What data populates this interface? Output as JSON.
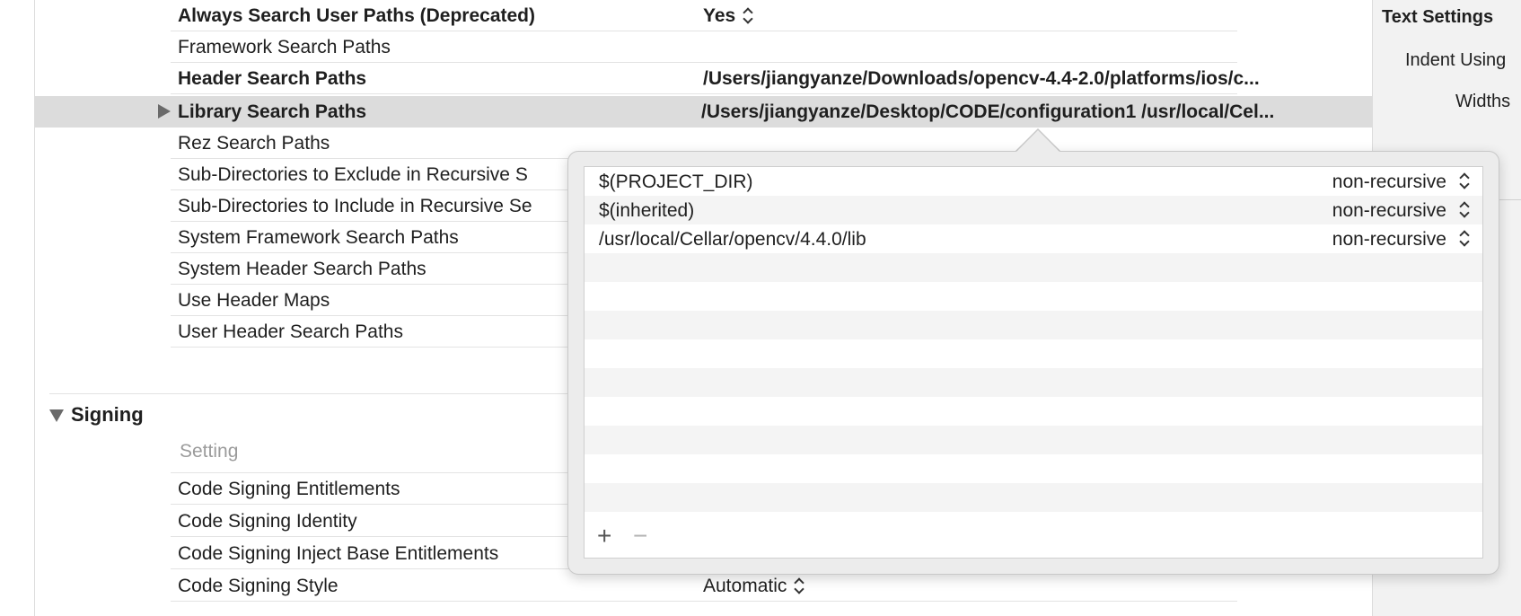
{
  "search_paths": {
    "rows": [
      {
        "name": "Always Search User Paths (Deprecated)",
        "value": "Yes",
        "bold": true,
        "stepper": true
      },
      {
        "name": "Framework Search Paths",
        "value": "",
        "bold": false,
        "stepper": false
      },
      {
        "name": "Header Search Paths",
        "value": "/Users/jiangyanze/Downloads/opencv-4.4-2.0/platforms/ios/c...",
        "bold": true,
        "stepper": false
      },
      {
        "name": "Library Search Paths",
        "value": "/Users/jiangyanze/Desktop/CODE/configuration1  /usr/local/Cel...",
        "bold": true,
        "stepper": false,
        "selected": true
      },
      {
        "name": "Rez Search Paths",
        "value": "",
        "bold": false
      },
      {
        "name": "Sub-Directories to Exclude in Recursive S",
        "value": "",
        "bold": false
      },
      {
        "name": "Sub-Directories to Include in Recursive Se",
        "value": "",
        "bold": false
      },
      {
        "name": "System Framework Search Paths",
        "value": "",
        "bold": false
      },
      {
        "name": "System Header Search Paths",
        "value": "",
        "bold": false
      },
      {
        "name": "Use Header Maps",
        "value": "",
        "bold": false
      },
      {
        "name": "User Header Search Paths",
        "value": "",
        "bold": false
      }
    ]
  },
  "signing": {
    "title": "Signing",
    "column_header": "Setting",
    "rows": [
      {
        "name": "Code Signing Entitlements",
        "value": ""
      },
      {
        "name": "Code Signing Identity",
        "value": ""
      },
      {
        "name": "Code Signing Inject Base Entitlements",
        "value": ""
      },
      {
        "name": "Code Signing Style",
        "value": "Automatic"
      }
    ]
  },
  "inspector": {
    "title": "Text Settings",
    "indent_label": "Indent Using",
    "widths_label": "Widths"
  },
  "popover": {
    "items": [
      {
        "path": "$(PROJECT_DIR)",
        "mode": "non-recursive"
      },
      {
        "path": "$(inherited)",
        "mode": "non-recursive"
      },
      {
        "path": "/usr/local/Cellar/opencv/4.4.0/lib",
        "mode": "non-recursive"
      }
    ],
    "add_label": "+",
    "remove_label": "−"
  }
}
